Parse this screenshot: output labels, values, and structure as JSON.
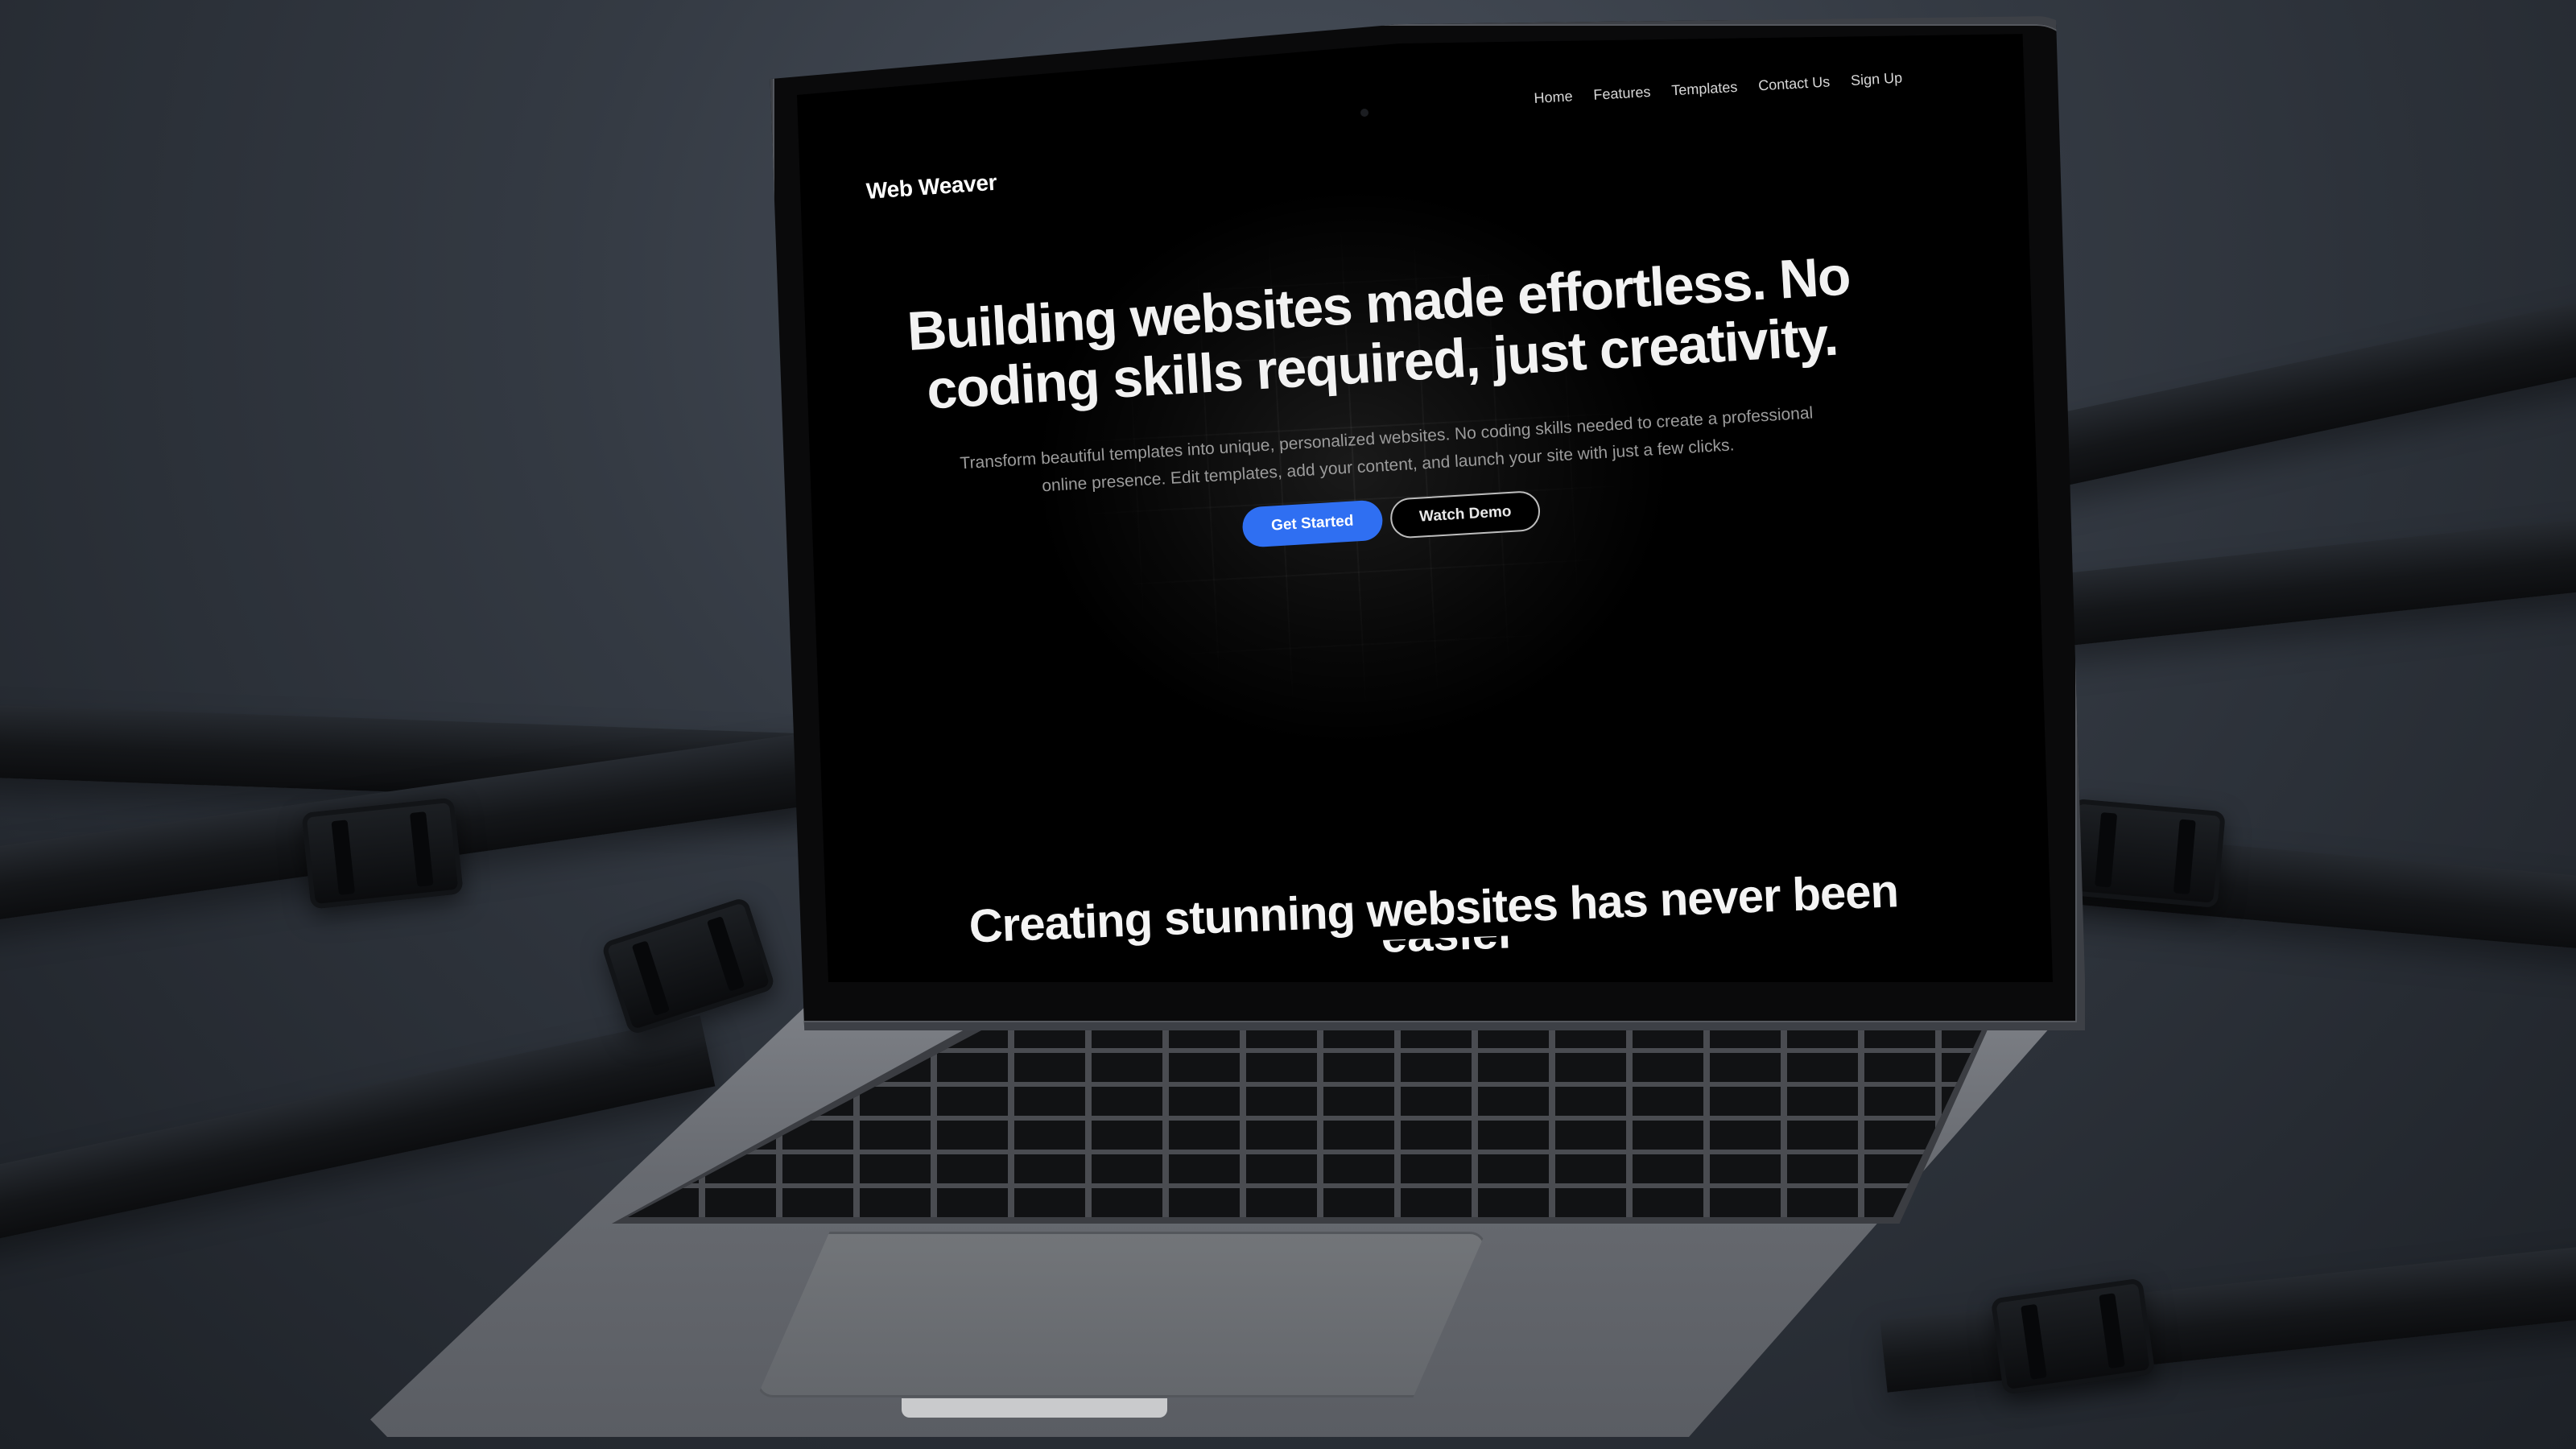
{
  "site": {
    "logo": "Web Weaver",
    "nav": {
      "home": "Home",
      "features": "Features",
      "templates": "Templates",
      "contact": "Contact Us",
      "signup": "Sign Up"
    },
    "hero": {
      "title": "Building websites made effortless. No coding skills required, just creativity.",
      "subtitle": "Transform beautiful templates into unique, personalized websites. No coding skills needed to create a professional online presence. Edit templates, add your content, and launch your site with just a few clicks.",
      "primary_button": "Get Started",
      "secondary_button": "Watch Demo"
    },
    "section": {
      "heading": "Creating stunning websites has never been",
      "heading_cut": "easier"
    }
  },
  "colors": {
    "accent": "#2f6ff2",
    "background": "#000000",
    "text": "#f2f2f2"
  }
}
